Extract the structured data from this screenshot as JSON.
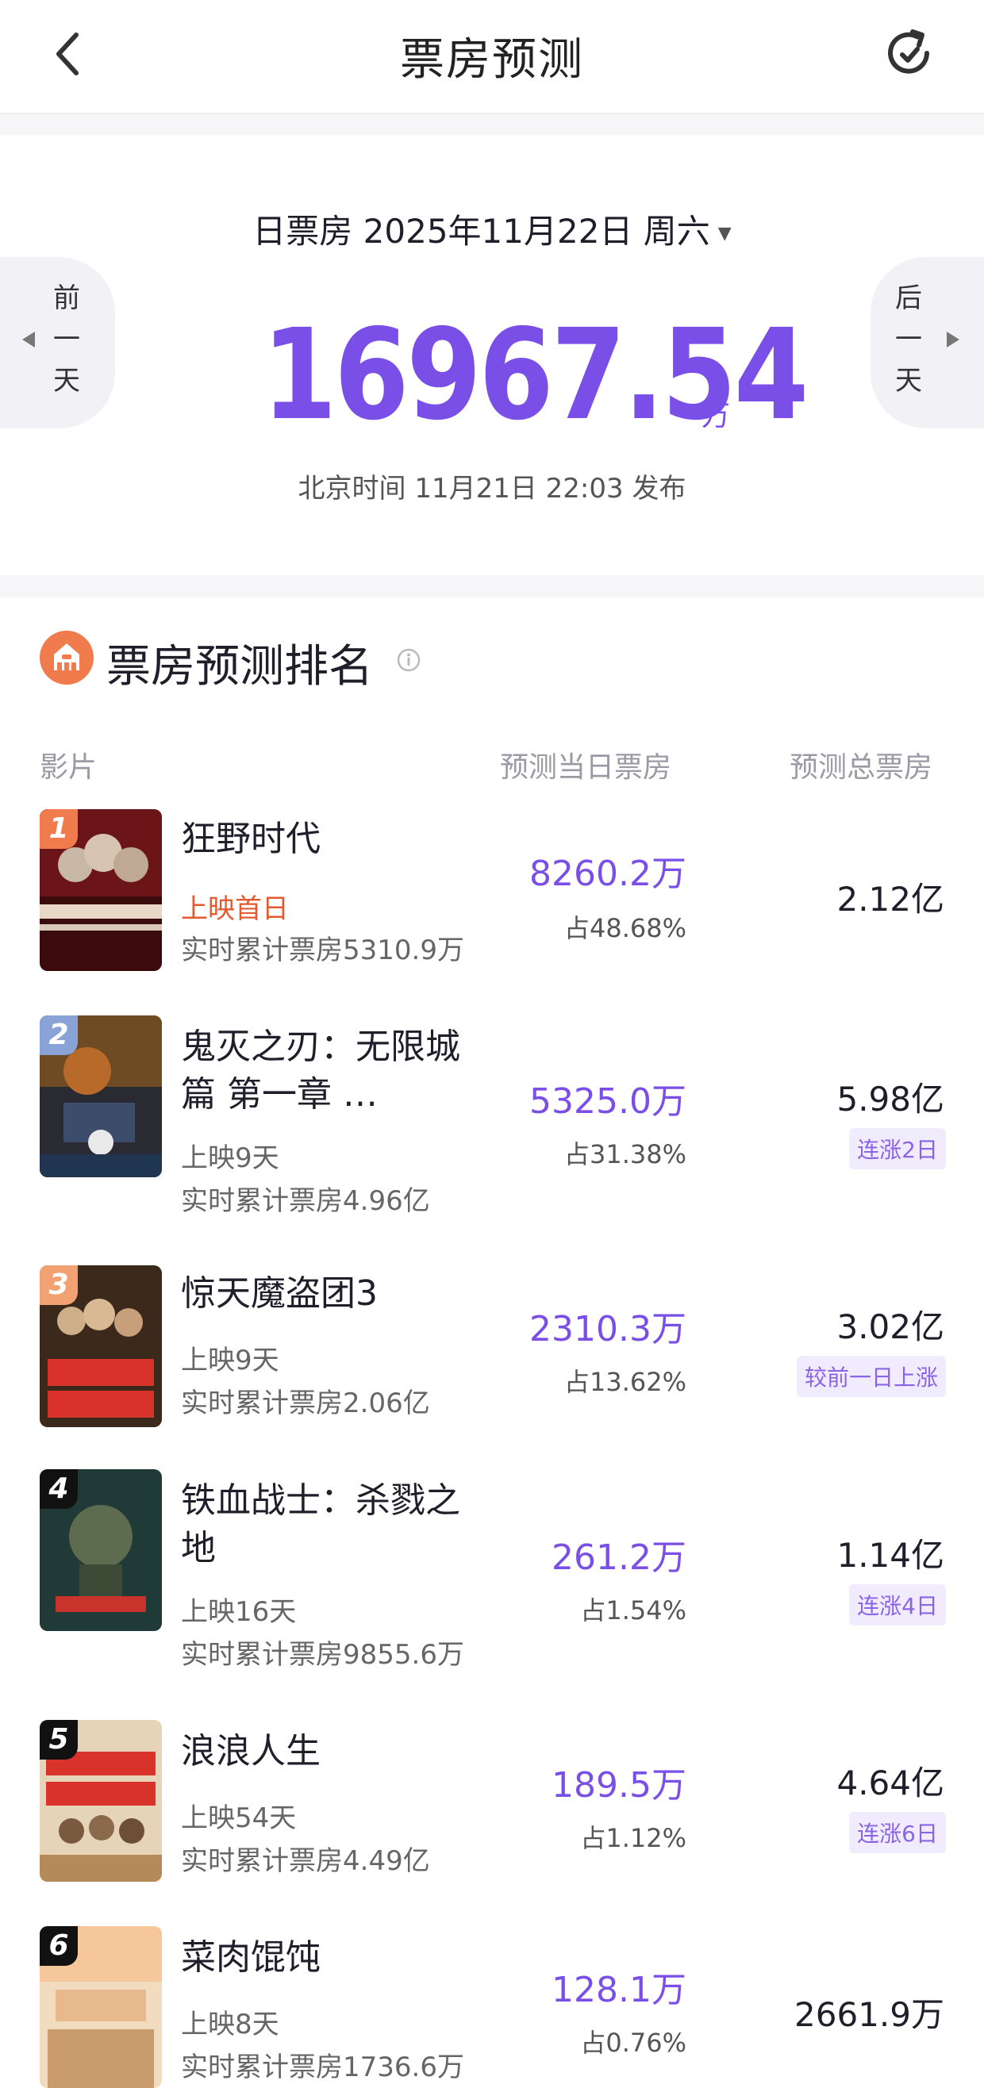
{
  "header": {
    "title": "票房预测"
  },
  "summary": {
    "date_label": "日票房 2025年11月22日 周六",
    "prev_label": "前一天",
    "next_label": "后一天",
    "amount": "16967.54",
    "unit": "万",
    "release_text": "北京时间 11月21日 22:03 发布"
  },
  "ranking": {
    "title": "票房预测排名",
    "col_film": "影片",
    "col_day": "预测当日票房",
    "col_total": "预测总票房",
    "movies": [
      {
        "rank": "1",
        "name": "狂野时代",
        "status": "上映首日",
        "cumulative": "实时累计票房5310.9万",
        "day_box": "8260.2万",
        "share": "占48.68%",
        "total": "2.12亿",
        "tag": ""
      },
      {
        "rank": "2",
        "name": "鬼灭之刃：无限城篇 第一章 …",
        "status": "上映9天",
        "cumulative": "实时累计票房4.96亿",
        "day_box": "5325.0万",
        "share": "占31.38%",
        "total": "5.98亿",
        "tag": "连涨2日"
      },
      {
        "rank": "3",
        "name": "惊天魔盗团3",
        "status": "上映9天",
        "cumulative": "实时累计票房2.06亿",
        "day_box": "2310.3万",
        "share": "占13.62%",
        "total": "3.02亿",
        "tag": "较前一日上涨"
      },
      {
        "rank": "4",
        "name": "铁血战士：杀戮之地",
        "status": "上映16天",
        "cumulative": "实时累计票房9855.6万",
        "day_box": "261.2万",
        "share": "占1.54%",
        "total": "1.14亿",
        "tag": "连涨4日"
      },
      {
        "rank": "5",
        "name": "浪浪人生",
        "status": "上映54天",
        "cumulative": "实时累计票房4.49亿",
        "day_box": "189.5万",
        "share": "占1.12%",
        "total": "4.64亿",
        "tag": "连涨6日"
      },
      {
        "rank": "6",
        "name": "菜肉馄饨",
        "status": "上映8天",
        "cumulative": "实时累计票房1736.6万",
        "day_box": "128.1万",
        "share": "占0.76%",
        "total": "2661.9万",
        "tag": ""
      }
    ]
  },
  "colors": {
    "accent": "#7a4fe8",
    "hot": "#e35a2f",
    "rank1": "#f07b4d",
    "rank2": "#8aa3d6",
    "rank3": "#f2a272",
    "rank_other": "#111111"
  }
}
